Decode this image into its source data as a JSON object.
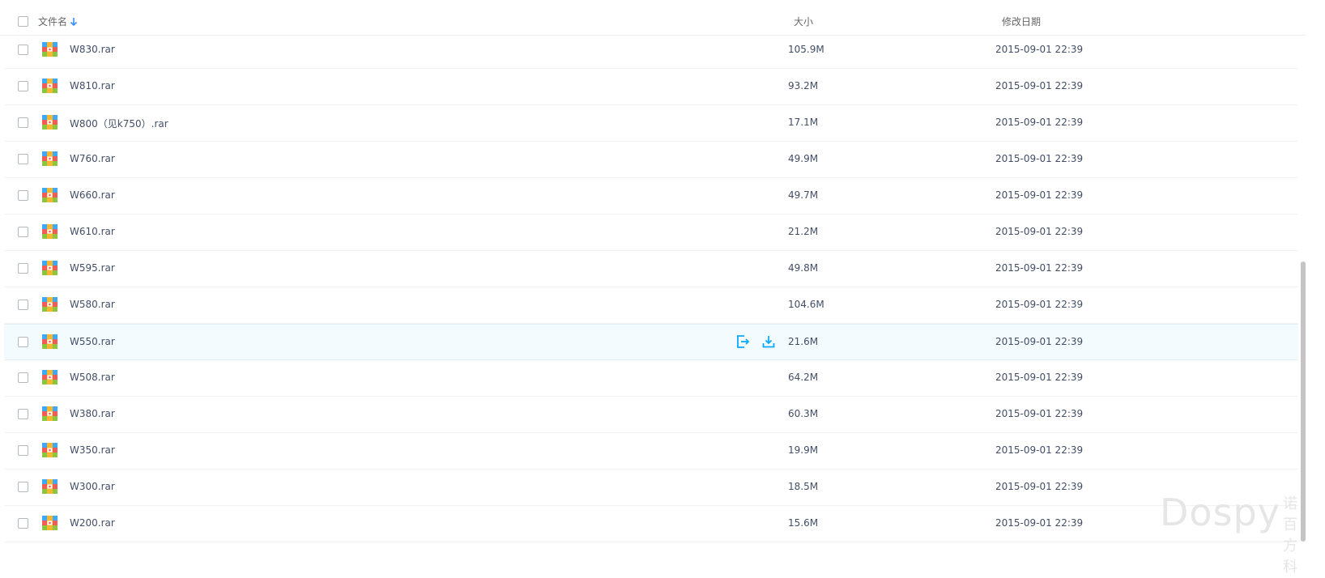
{
  "header": {
    "name_label": "文件名",
    "size_label": "大小",
    "date_label": "修改日期"
  },
  "files": [
    {
      "name": "W830.rar",
      "size": "105.9M",
      "date": "2015-09-01 22:39"
    },
    {
      "name": "W810.rar",
      "size": "93.2M",
      "date": "2015-09-01 22:39"
    },
    {
      "name": "W800（见k750）.rar",
      "size": "17.1M",
      "date": "2015-09-01 22:39"
    },
    {
      "name": "W760.rar",
      "size": "49.9M",
      "date": "2015-09-01 22:39"
    },
    {
      "name": "W660.rar",
      "size": "49.7M",
      "date": "2015-09-01 22:39"
    },
    {
      "name": "W610.rar",
      "size": "21.2M",
      "date": "2015-09-01 22:39"
    },
    {
      "name": "W595.rar",
      "size": "49.8M",
      "date": "2015-09-01 22:39"
    },
    {
      "name": "W580.rar",
      "size": "104.6M",
      "date": "2015-09-01 22:39"
    },
    {
      "name": "W550.rar",
      "size": "21.6M",
      "date": "2015-09-01 22:39"
    },
    {
      "name": "W508.rar",
      "size": "64.2M",
      "date": "2015-09-01 22:39"
    },
    {
      "name": "W380.rar",
      "size": "60.3M",
      "date": "2015-09-01 22:39"
    },
    {
      "name": "W350.rar",
      "size": "19.9M",
      "date": "2015-09-01 22:39"
    },
    {
      "name": "W300.rar",
      "size": "18.5M",
      "date": "2015-09-01 22:39"
    },
    {
      "name": "W200.rar",
      "size": "15.6M",
      "date": "2015-09-01 22:39"
    }
  ],
  "hovered_row": 8,
  "icons": {
    "sort": "sort-down-arrow-icon",
    "file": "rar-archive-icon",
    "share": "share-icon",
    "download": "download-icon"
  },
  "colors": {
    "accent": "#09aaff",
    "text": "#424e67",
    "header_text": "#666666",
    "hover_bg": "#f4fbff"
  },
  "watermark": {
    "text": "Dospy",
    "cn": "诺百方科"
  }
}
